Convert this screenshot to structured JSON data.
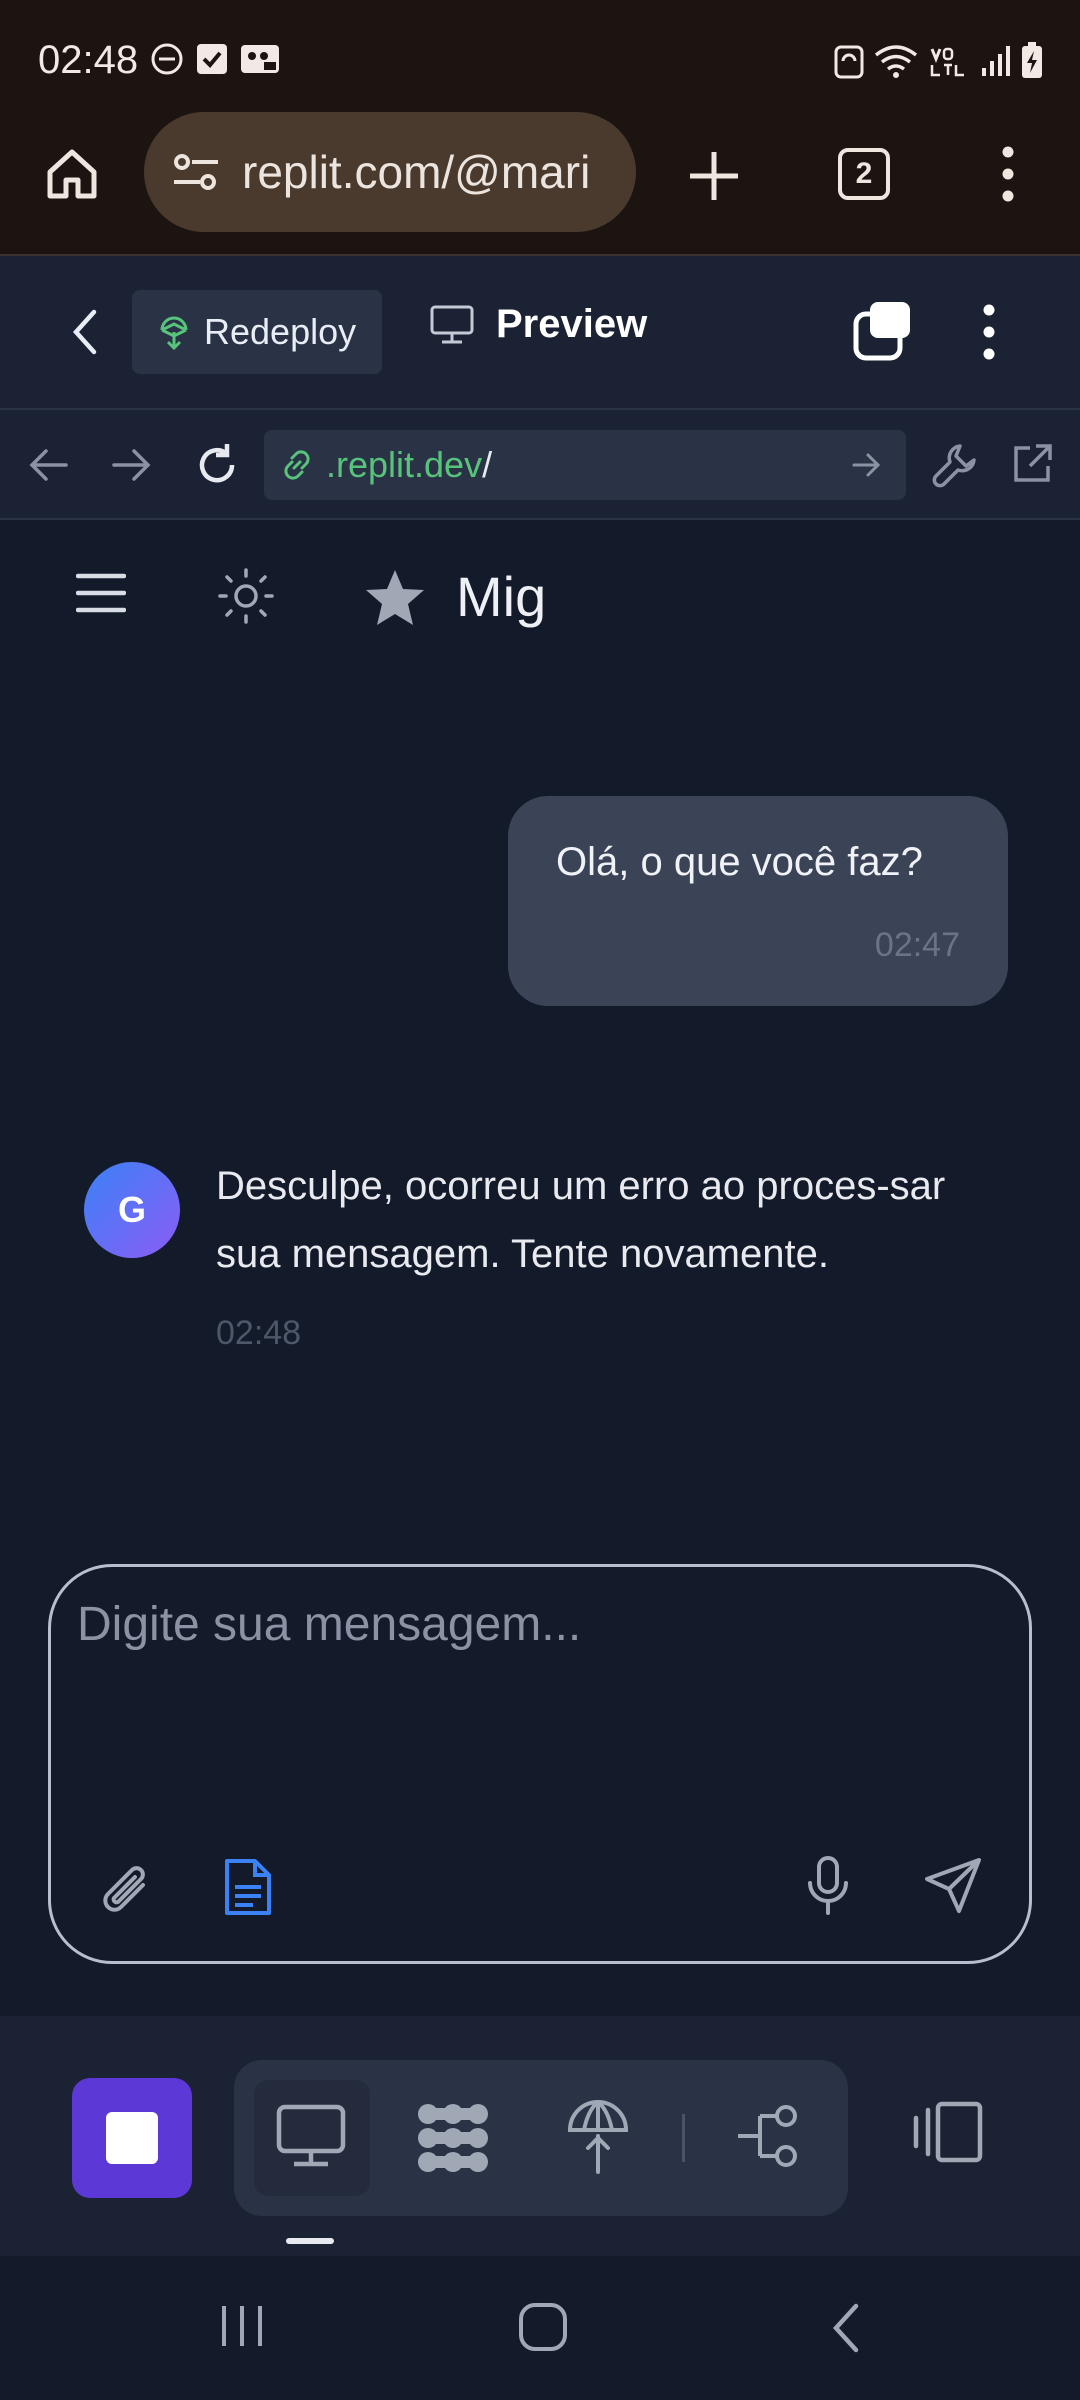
{
  "status_bar": {
    "time": "02:48"
  },
  "browser": {
    "url": "replit.com/@mari",
    "tab_count": "2"
  },
  "replit_header": {
    "redeploy_label": "Redeploy",
    "preview_label": "Preview"
  },
  "webview": {
    "domain": ".replit.dev",
    "path": "/"
  },
  "app": {
    "title": "Mig"
  },
  "messages": [
    {
      "role": "user",
      "text": "Olá, o que você faz?",
      "time": "02:47"
    },
    {
      "role": "assistant",
      "avatar": "G",
      "text": "Desculpe, ocorreu um erro ao proces-sar sua mensagem. Tente novamente.",
      "time": "02:48"
    }
  ],
  "composer": {
    "placeholder": "Digite sua mensagem..."
  },
  "colors": {
    "accent": "#5c38d6",
    "link_green": "#58c37a",
    "doc_blue": "#3b82f6"
  }
}
